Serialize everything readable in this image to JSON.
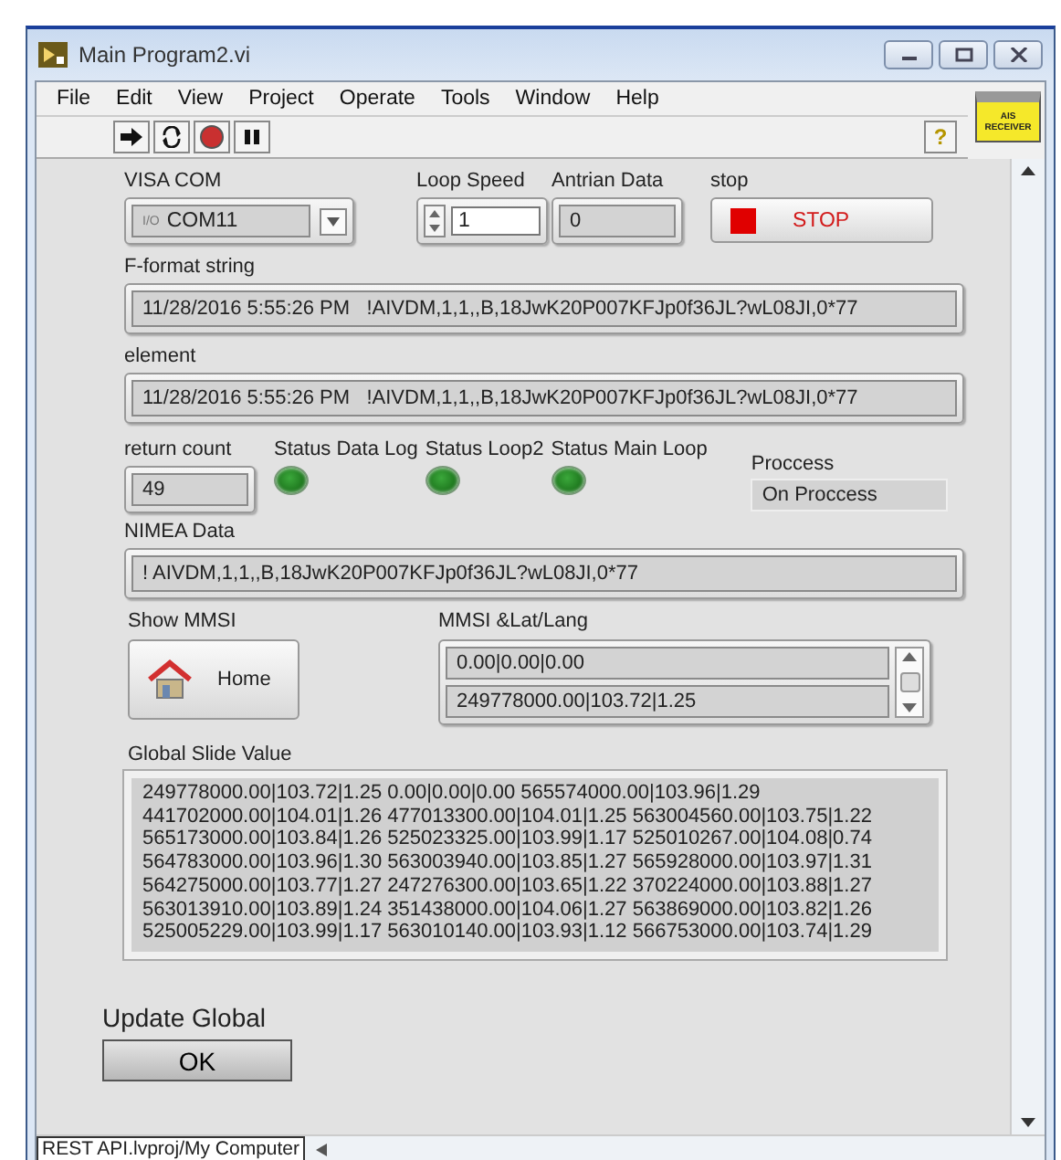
{
  "window": {
    "title": "Main Program2.vi"
  },
  "menu": [
    "File",
    "Edit",
    "View",
    "Project",
    "Operate",
    "Tools",
    "Window",
    "Help"
  ],
  "ais_icon": {
    "text": "AIS RECEIVER"
  },
  "help_button": "?",
  "visa_com": {
    "label": "VISA COM",
    "value": "COM11",
    "prefix": "I/O"
  },
  "loop_speed": {
    "label": "Loop Speed",
    "value": "1"
  },
  "antrian_data": {
    "label": "Antrian Data",
    "value": "0"
  },
  "stop": {
    "label": "stop",
    "button": "STOP"
  },
  "f_format_string": {
    "label": "F-format string",
    "value": "11/28/2016 5:55:26 PM   !AIVDM,1,1,,B,18JwK20P007KFJp0f36JL?wL08JI,0*77"
  },
  "element": {
    "label": "element",
    "value": "11/28/2016 5:55:26 PM   !AIVDM,1,1,,B,18JwK20P007KFJp0f36JL?wL08JI,0*77"
  },
  "return_count": {
    "label": "return count",
    "value": "49"
  },
  "status_lights": [
    {
      "label": "Status Data Log",
      "on": true
    },
    {
      "label": "Status Loop2",
      "on": true
    },
    {
      "label": "Status Main Loop",
      "on": true
    }
  ],
  "process": {
    "label": "Proccess",
    "value": "On Proccess"
  },
  "nimea_data": {
    "label": "NIMEA Data",
    "value": "! AIVDM,1,1,,B,18JwK20P007KFJp0f36JL?wL08JI,0*77"
  },
  "show_mmsi": {
    "label": "Show MMSI",
    "button": "Home"
  },
  "mmsi_latlang": {
    "label": "MMSI &Lat/Lang",
    "items": [
      "0.00|0.00|0.00",
      "249778000.00|103.72|1.25"
    ]
  },
  "global_slide_value": {
    "label": "Global Slide Value",
    "lines": [
      "249778000.00|103.72|1.25 0.00|0.00|0.00 565574000.00|103.96|1.29",
      "441702000.00|104.01|1.26 477013300.00|104.01|1.25 563004560.00|103.75|1.22",
      "565173000.00|103.84|1.26 525023325.00|103.99|1.17 525010267.00|104.08|0.74",
      "564783000.00|103.96|1.30 563003940.00|103.85|1.27 565928000.00|103.97|1.31",
      "564275000.00|103.77|1.27 247276300.00|103.65|1.22 370224000.00|103.88|1.27",
      "563013910.00|103.89|1.24 351438000.00|104.06|1.27 563869000.00|103.82|1.26",
      "525005229.00|103.99|1.17 563010140.00|103.93|1.12 566753000.00|103.74|1.29"
    ]
  },
  "update_global": {
    "label": "Update Global",
    "button": "OK"
  },
  "status_bar": {
    "text": "REST API.lvproj/My Computer"
  }
}
